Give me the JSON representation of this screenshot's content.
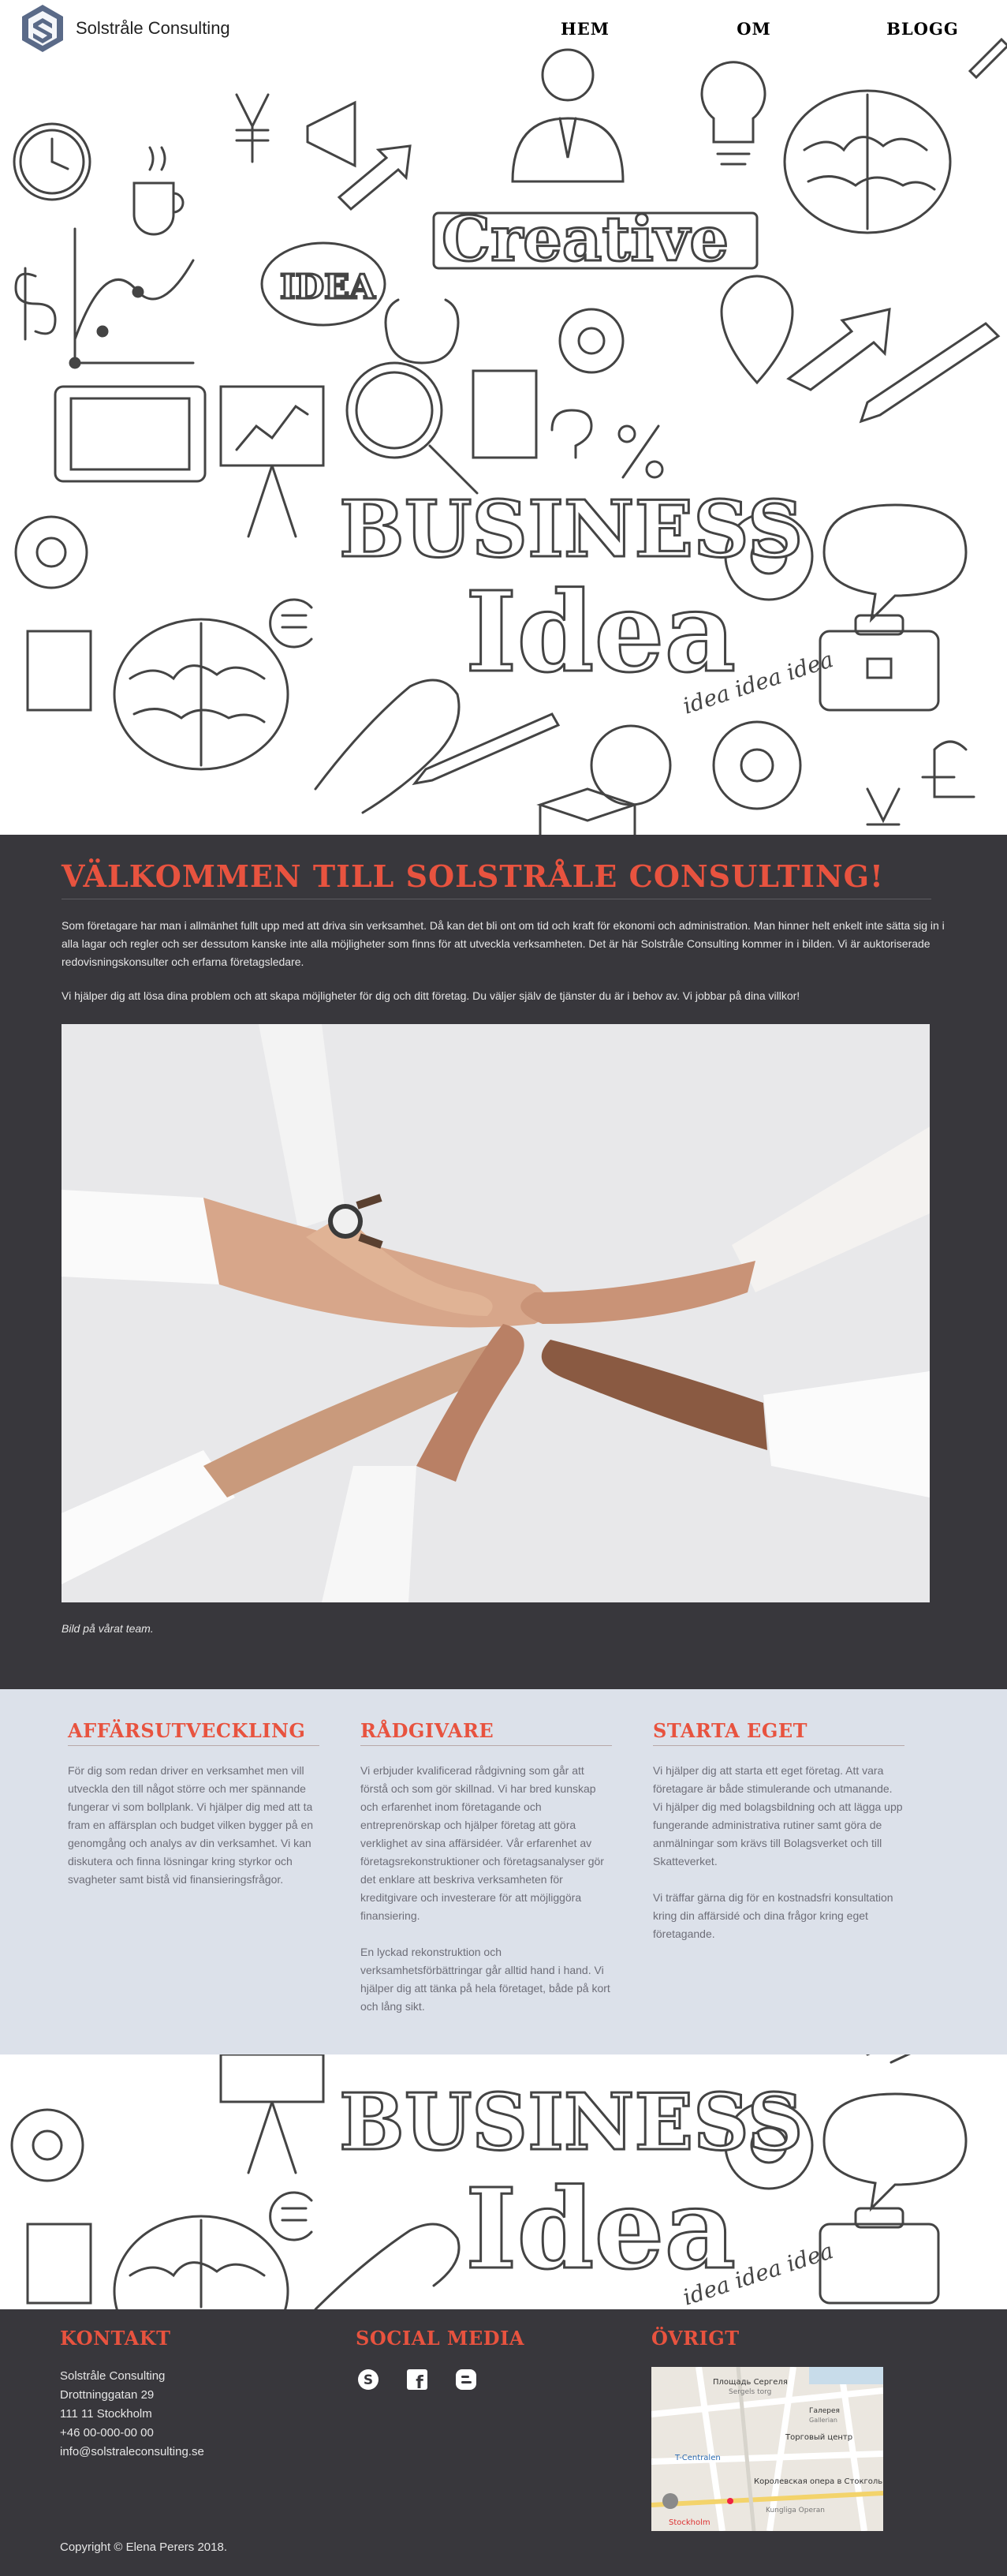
{
  "header": {
    "logo_text": "Solstråle Consulting",
    "nav": [
      {
        "label": "HEM"
      },
      {
        "label": "OM"
      },
      {
        "label": "BLOGG"
      }
    ]
  },
  "hero": {
    "doodle_words": [
      "Creative",
      "IDEA",
      "BUSINESS",
      "Idea",
      "idea idea idea"
    ]
  },
  "welcome": {
    "title": "VÄLKOMMEN TILL SOLSTRÅLE CONSULTING!",
    "paragraph1": "Som företagare har man i allmänhet fullt upp med att driva sin verksamhet. Då kan det bli ont om tid och kraft för ekonomi och administration. Man hinner helt enkelt inte sätta sig in i alla lagar och regler och ser dessutom kanske inte alla möjligheter som finns för att utveckla verksamheten. Det är här Solstråle Consulting kommer in i bilden. Vi är auktoriserade redovisningskonsulter och erfarna företagsledare.",
    "paragraph2": "Vi hjälper dig att lösa dina problem och att skapa möjligheter för dig och ditt företag. Du väljer själv de tjänster du är i behov av. Vi jobbar på dina villkor!",
    "caption": "Bild på vårat team."
  },
  "services": [
    {
      "title": "AFFÄRSUTVECKLING",
      "paragraphs": [
        "För dig som redan driver en verksamhet men vill utveckla den till något större och mer spännande fungerar vi som bollplank. Vi hjälper dig med att ta fram en affärsplan och budget vilken bygger på en genomgång och analys av din verksamhet. Vi kan diskutera och finna lösningar kring styrkor och svagheter samt bistå vid finansieringsfrågor."
      ]
    },
    {
      "title": "RÅDGIVARE",
      "paragraphs": [
        "Vi erbjuder kvalificerad rådgivning som går att förstå och som gör skillnad. Vi har bred kunskap och erfarenhet inom företagande och entreprenörskap och hjälper företag att göra verklighet av sina affärsidéer. Vår erfarenhet av företagsrekonstruktioner och företagsanalyser gör det enklare att beskriva verksamheten för kreditgivare och investerare för att möjliggöra finansiering.",
        "En lyckad rekonstruktion och verksamhetsförbättringar går alltid hand i hand. Vi hjälper dig att tänka på hela företaget, både på kort och lång sikt."
      ]
    },
    {
      "title": "STARTA EGET",
      "paragraphs": [
        "Vi hjälper dig att starta ett eget företag. Att vara företagare är både stimulerande och utmanande. Vi hjälper dig med bolagsbildning och att lägga upp fungerande administrativa rutiner samt göra de anmälningar som krävs till Bolagsverket och till Skatteverket.",
        "Vi träffar gärna dig för en kostnadsfri konsultation kring din affärsidé och dina frågor kring eget företagande."
      ]
    }
  ],
  "strip": {
    "doodle_words": [
      "BUSINESS",
      "Idea",
      "idea idea idea"
    ]
  },
  "footer": {
    "contact_title": "KONTAKT",
    "contact_lines": [
      "Solstråle Consulting",
      "Drottninggatan 29",
      "111 11 Stockholm",
      "+46 00-000-00 00",
      "info@solstraleconsulting.se"
    ],
    "social_title": "SOCIAL MEDIA",
    "social_icons": [
      "skype-icon",
      "facebook-icon",
      "blogger-icon"
    ],
    "other_title": "ÖVRIGT",
    "map_labels": [
      "Площадь Сергеля",
      "Sergels torg",
      "Галерея",
      "Gallerian",
      "Торговый центр",
      "T-Centralen",
      "Королевская опера в Стокгольме",
      "Kungliga Operan",
      "Stockholm"
    ],
    "copyright": "Copyright © Elena Perers 2018."
  },
  "colors": {
    "accent": "#e8533f",
    "dark_bg": "#38373c",
    "services_bg": "#dce1ea"
  }
}
